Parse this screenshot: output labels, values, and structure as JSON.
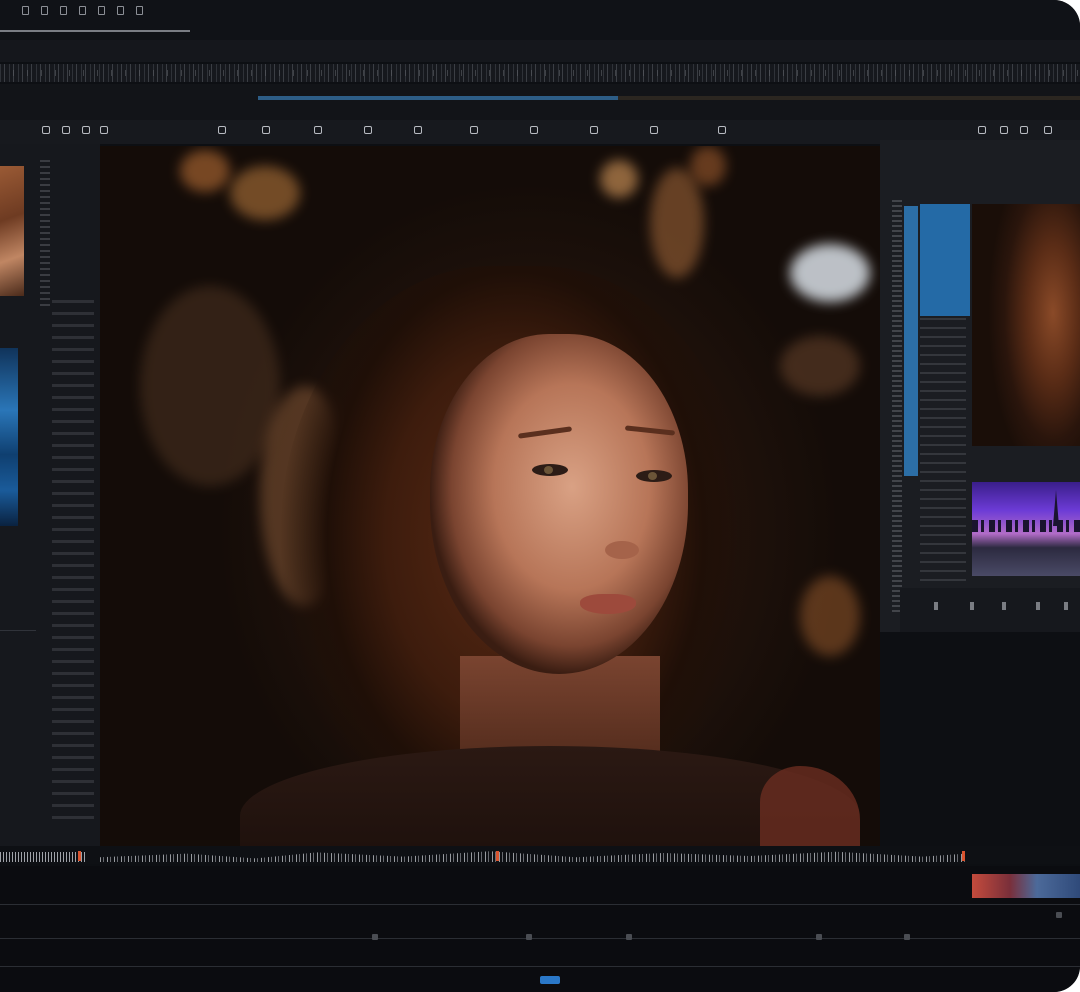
{
  "app": {
    "title": "",
    "accent_color": "#2c6ea6",
    "marker_color": "#d46a40"
  },
  "menu_bar": {
    "icons": [
      "menu-icon",
      "file-icon",
      "grid-icon",
      "layers-icon",
      "panel-icon",
      "settings-icon",
      "window-icon"
    ]
  },
  "tabs": [
    {
      "label": ""
    },
    {
      "label": ""
    },
    {
      "label": ""
    },
    {
      "label": ""
    },
    {
      "label": ""
    },
    {
      "label": ""
    },
    {
      "label": ""
    }
  ],
  "toolbar": {
    "tools": [
      "play-icon",
      "pause-icon",
      "stop-icon",
      "step-back-icon",
      "step-forward-icon",
      "loop-icon",
      "marker-icon",
      "trim-icon",
      "split-icon",
      "zoom-icon"
    ],
    "right_tools": [
      "audio-icon",
      "settings-icon",
      "record-icon",
      "export-icon",
      "more-icon"
    ]
  },
  "viewer": {
    "content": "video-frame"
  },
  "right_panel": {
    "clips": [
      {
        "thumbnail": "portrait-clip"
      },
      {
        "thumbnail": "city-skyline-clip"
      }
    ]
  },
  "waveform": {
    "peak_color": "#d9542f"
  }
}
